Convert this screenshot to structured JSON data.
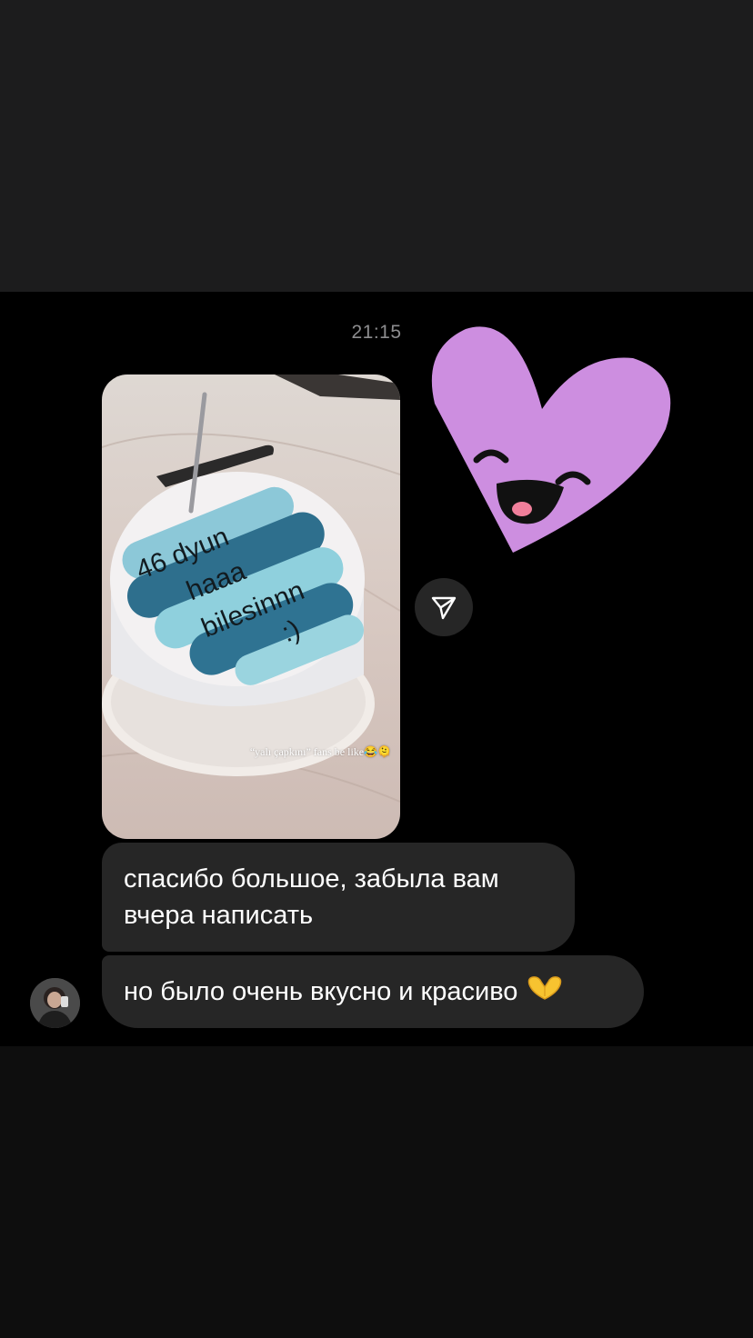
{
  "chat": {
    "timestamp": "21:15",
    "story": {
      "cake_text": [
        "46 dyun",
        "haaa",
        "bilesinnn",
        ":)"
      ],
      "caption": "“yalı çapkını” fans be like😂🫠"
    },
    "messages": [
      {
        "text": "спасибо большое, забыла вам вчера написать"
      },
      {
        "text": "но было очень вкусно и красиво",
        "emoji": "heart-hands"
      }
    ]
  },
  "icons": {
    "share": "paper-plane-icon",
    "sticker": "smiling-heart-sticker",
    "emoji": "heart-hands-icon"
  },
  "colors": {
    "bubble": "#262626",
    "heart": "#cd8ee0",
    "timestamp": "#8d8d8f"
  }
}
